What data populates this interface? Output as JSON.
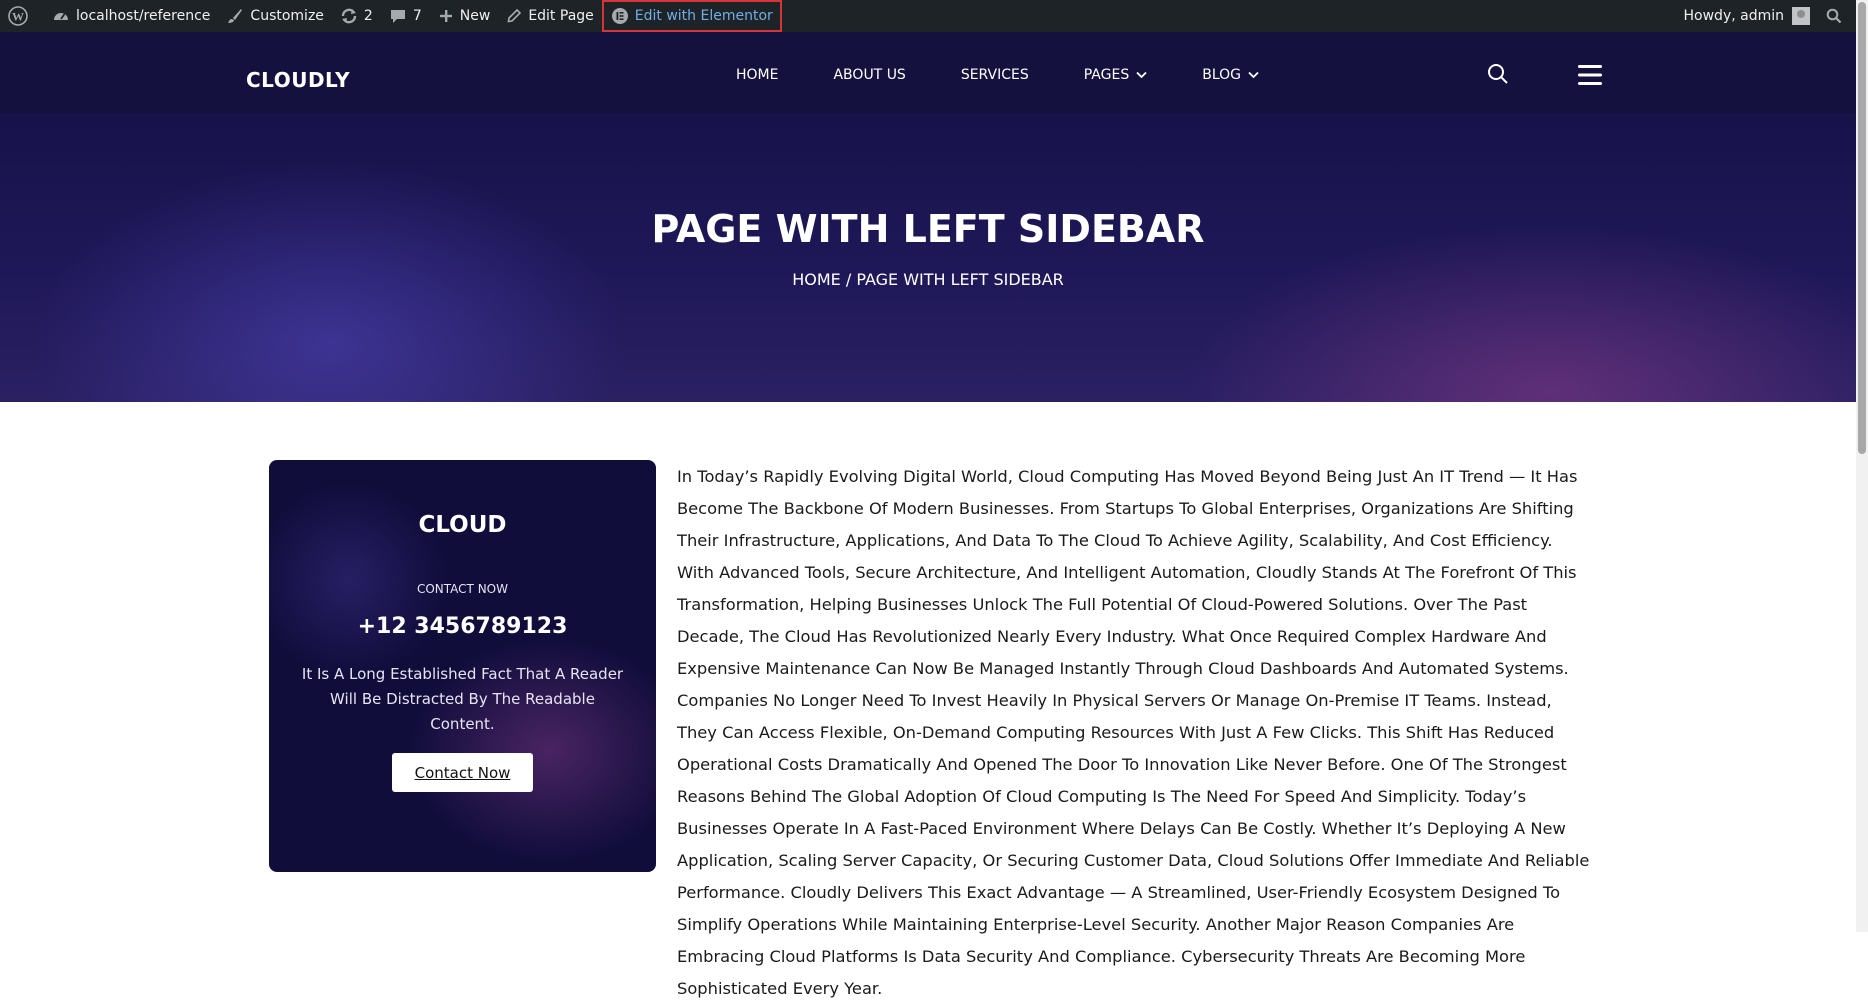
{
  "admin_bar": {
    "site": "localhost/reference",
    "customize": "Customize",
    "updates": "2",
    "comments": "7",
    "new": "New",
    "edit_page": "Edit Page",
    "elementor": "Edit with Elementor",
    "greeting": "Howdy, admin"
  },
  "header": {
    "logo": "CLOUDLY",
    "nav": [
      "HOME",
      "ABOUT US",
      "SERVICES",
      "PAGES",
      "BLOG"
    ]
  },
  "hero": {
    "title": "PAGE WITH LEFT SIDEBAR",
    "breadcrumb": "HOME / PAGE WITH LEFT SIDEBAR"
  },
  "sidebar_card": {
    "title": "CLOUD",
    "eyebrow": "CONTACT NOW",
    "phone": "+12 3456789123",
    "text": "It Is A Long Established Fact That A Reader Will Be Distracted By The Readable Content.",
    "button": "Contact Now"
  },
  "content": {
    "paragraph": "In Today’s Rapidly Evolving Digital World, Cloud Computing Has Moved Beyond Being Just An IT Trend — It Has Become The Backbone Of Modern Businesses. From Startups To Global Enterprises, Organizations Are Shifting Their Infrastructure, Applications, And Data To The Cloud To Achieve Agility, Scalability, And Cost Efficiency. With Advanced Tools, Secure Architecture, And Intelligent Automation, Cloudly Stands At The Forefront Of This Transformation, Helping Businesses Unlock The Full Potential Of Cloud-Powered Solutions. Over The Past Decade, The Cloud Has Revolutionized Nearly Every Industry. What Once Required Complex Hardware And Expensive Maintenance Can Now Be Managed Instantly Through Cloud Dashboards And Automated Systems. Companies No Longer Need To Invest Heavily In Physical Servers Or Manage On-Premise IT Teams. Instead, They Can Access Flexible, On-Demand Computing Resources With Just A Few Clicks. This Shift Has Reduced Operational Costs Dramatically And Opened The Door To Innovation Like Never Before. One Of The Strongest Reasons Behind The Global Adoption Of Cloud Computing Is The Need For Speed And Simplicity. Today’s Businesses Operate In A Fast-Paced Environment Where Delays Can Be Costly. Whether It’s Deploying A New Application, Scaling Server Capacity, Or Securing Customer Data, Cloud Solutions Offer Immediate And Reliable Performance. Cloudly Delivers This Exact Advantage — A Streamlined, User-Friendly Ecosystem Designed To Simplify Operations While Maintaining Enterprise-Level Security. Another Major Reason Companies Are Embracing Cloud Platforms Is Data Security And Compliance. Cybersecurity Threats Are Becoming More Sophisticated Every Year."
  }
}
